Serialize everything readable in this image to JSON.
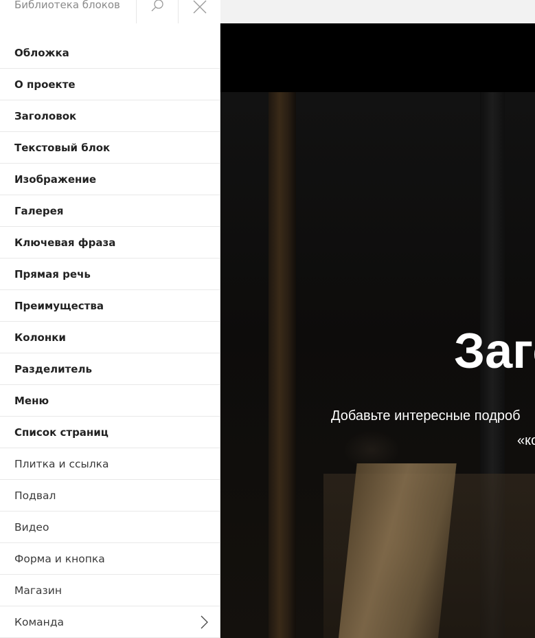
{
  "search": {
    "placeholder": "Библиотека блоков"
  },
  "icons": {
    "search": "search-icon",
    "close": "close-icon",
    "chevron": "chevron-right-icon"
  },
  "sidebar": {
    "items": [
      {
        "label": "Обложка",
        "weight": "bold"
      },
      {
        "label": "О проекте",
        "weight": "bold"
      },
      {
        "label": "Заголовок",
        "weight": "bold"
      },
      {
        "label": "Текстовый блок",
        "weight": "bold"
      },
      {
        "label": "Изображение",
        "weight": "bold"
      },
      {
        "label": "Галерея",
        "weight": "bold"
      },
      {
        "label": "Ключевая фраза",
        "weight": "bold"
      },
      {
        "label": "Прямая речь",
        "weight": "bold"
      },
      {
        "label": "Преимущества",
        "weight": "bold"
      },
      {
        "label": "Колонки",
        "weight": "bold"
      },
      {
        "label": "Разделитель",
        "weight": "bold"
      },
      {
        "label": "Меню",
        "weight": "bold"
      },
      {
        "label": "Список страниц",
        "weight": "bold"
      },
      {
        "label": "Плитка и ссылка",
        "weight": "light"
      },
      {
        "label": "Подвал",
        "weight": "light"
      },
      {
        "label": "Видео",
        "weight": "light"
      },
      {
        "label": "Форма и кнопка",
        "weight": "light"
      },
      {
        "label": "Магазин",
        "weight": "light"
      },
      {
        "label": "Команда",
        "weight": "light"
      }
    ]
  },
  "preview": {
    "title": "Заго",
    "subtitle_line1": "Добавьте интересные подроб",
    "subtitle_line2": "«ко"
  },
  "colors": {
    "sidebar_bg": "#ffffff",
    "preview_bg": "#000000",
    "text_dark": "#222222"
  }
}
